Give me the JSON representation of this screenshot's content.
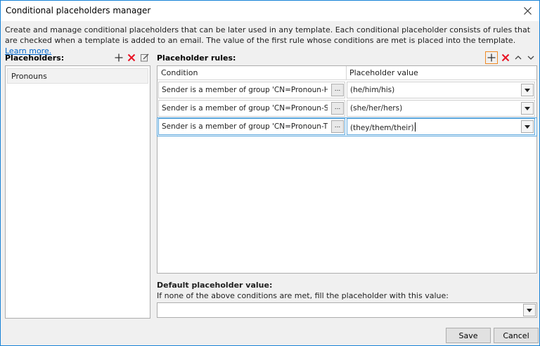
{
  "window": {
    "title": "Conditional placeholders manager"
  },
  "description": {
    "text": "Create and manage conditional placeholders that can be later used in any template. Each conditional placeholder consists of rules that are checked when a template is added to an email. The value of the first rule whose conditions are met is placed into the template.",
    "link": "Learn more."
  },
  "placeholders": {
    "label": "Placeholders:",
    "items": [
      "Pronouns"
    ]
  },
  "rules": {
    "label": "Placeholder rules:",
    "columns": {
      "condition": "Condition",
      "value": "Placeholder value"
    },
    "rows": [
      {
        "condition": "Sender is a member of group 'CN=Pronoun-He,...",
        "value": "(he/him/his)"
      },
      {
        "condition": "Sender is a member of group 'CN=Pronoun-She,...",
        "value": "(she/her/hers)"
      },
      {
        "condition": "Sender is a member of group 'CN=Pronoun-The...",
        "value": "(they/them/their)"
      }
    ],
    "dots_label": "..."
  },
  "default": {
    "label": "Default placeholder value:",
    "help": "If none of the above conditions are met, fill the placeholder with this value:",
    "value": ""
  },
  "buttons": {
    "save": "Save",
    "cancel": "Cancel"
  },
  "colors": {
    "add": "#333333",
    "delete": "#e81123",
    "accent": "#f08a24",
    "border": "#1883d7"
  }
}
